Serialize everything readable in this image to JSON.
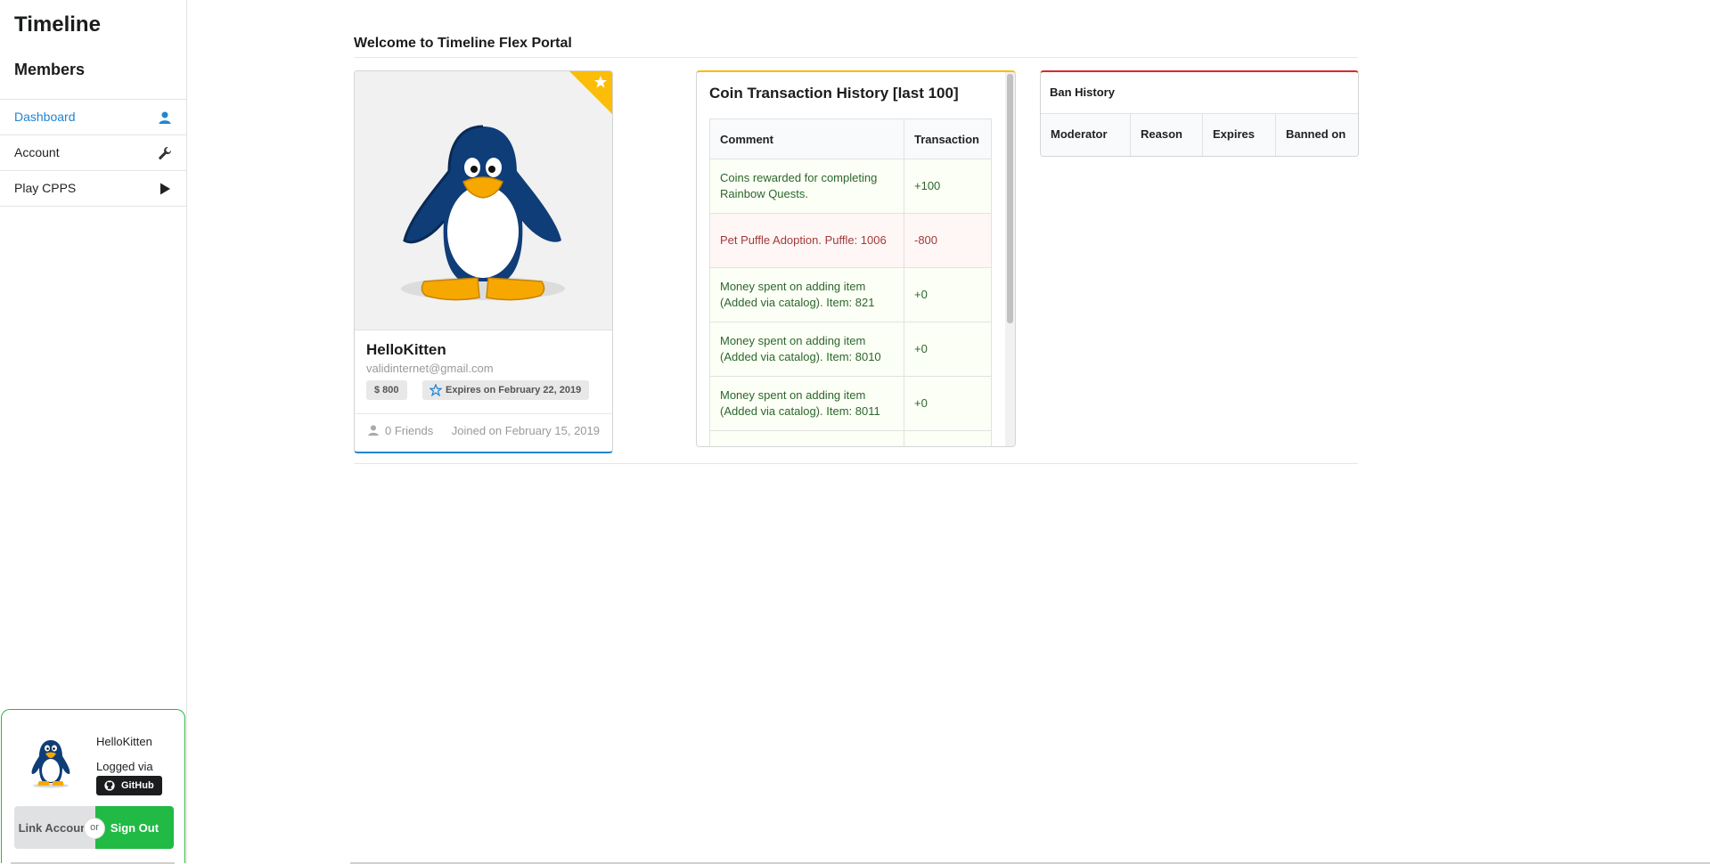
{
  "sidebar": {
    "brand": "Timeline",
    "section": "Members",
    "items": [
      {
        "label": "Dashboard",
        "icon": "user-icon",
        "active": true
      },
      {
        "label": "Account",
        "icon": "wrench-icon"
      },
      {
        "label": "Play CPPS",
        "icon": "play-icon"
      }
    ]
  },
  "user_card": {
    "name": "HelloKitten",
    "logged_via": "Logged via",
    "provider": "GitHub",
    "link_label": "Link Account",
    "or_label": "or",
    "signout_label": "Sign Out"
  },
  "main": {
    "welcome": "Welcome to Timeline Flex Portal"
  },
  "profile": {
    "name": "HelloKitten",
    "email": "validinternet@gmail.com",
    "coins": "$ 800",
    "expires": "Expires on February 22, 2019",
    "friends": "0 Friends",
    "joined": "Joined on February 15, 2019"
  },
  "coins": {
    "title": "Coin Transaction History [last 100]",
    "columns": [
      "Comment",
      "Transaction"
    ],
    "rows": [
      {
        "comment": "Coins rewarded for completing Rainbow Quests.",
        "amount": "+100",
        "type": "positive"
      },
      {
        "comment": "Pet Puffle Adoption. Puffle: 1006",
        "amount": "-800",
        "type": "negative"
      },
      {
        "comment": "Money spent on adding item (Added via catalog). Item: 821",
        "amount": "+0",
        "type": "positive"
      },
      {
        "comment": "Money spent on adding item (Added via catalog). Item: 8010",
        "amount": "+0",
        "type": "positive"
      },
      {
        "comment": "Money spent on adding item (Added via catalog). Item: 8011",
        "amount": "+0",
        "type": "positive"
      }
    ]
  },
  "ban": {
    "title": "Ban History",
    "columns": [
      "Moderator",
      "Reason",
      "Expires",
      "Banned on"
    ]
  },
  "colors": {
    "accent": "#2185d0",
    "green": "#21ba45",
    "yellow": "#fbbd08",
    "red": "#db2828"
  }
}
